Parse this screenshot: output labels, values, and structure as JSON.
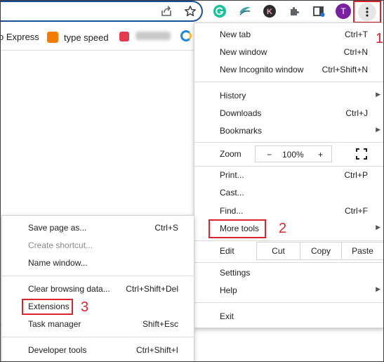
{
  "toolbar": {
    "avatar_initial": "T",
    "k_initial": "K"
  },
  "bookmarks": {
    "express": "o Express",
    "type_speed": "type speed"
  },
  "menu": {
    "new_tab": {
      "label": "New tab",
      "shortcut": "Ctrl+T"
    },
    "new_window": {
      "label": "New window",
      "shortcut": "Ctrl+N"
    },
    "new_incognito": {
      "label": "New Incognito window",
      "shortcut": "Ctrl+Shift+N"
    },
    "history": {
      "label": "History"
    },
    "downloads": {
      "label": "Downloads",
      "shortcut": "Ctrl+J"
    },
    "bookmarks": {
      "label": "Bookmarks"
    },
    "zoom": {
      "label": "Zoom",
      "minus": "−",
      "value": "100%",
      "plus": "+"
    },
    "print": {
      "label": "Print...",
      "shortcut": "Ctrl+P"
    },
    "cast": {
      "label": "Cast..."
    },
    "find": {
      "label": "Find...",
      "shortcut": "Ctrl+F"
    },
    "more_tools": {
      "label": "More tools"
    },
    "edit": {
      "label": "Edit",
      "cut": "Cut",
      "copy": "Copy",
      "paste": "Paste"
    },
    "settings": {
      "label": "Settings"
    },
    "help": {
      "label": "Help"
    },
    "exit": {
      "label": "Exit"
    }
  },
  "submenu": {
    "save_page": {
      "label": "Save page as...",
      "shortcut": "Ctrl+S"
    },
    "create_shortcut": {
      "label": "Create shortcut..."
    },
    "name_window": {
      "label": "Name window..."
    },
    "clear_browsing": {
      "label": "Clear browsing data...",
      "shortcut": "Ctrl+Shift+Del"
    },
    "extensions": {
      "label": "Extensions"
    },
    "task_manager": {
      "label": "Task manager",
      "shortcut": "Shift+Esc"
    },
    "developer_tools": {
      "label": "Developer tools",
      "shortcut": "Ctrl+Shift+I"
    }
  },
  "annotations": {
    "step1": "1",
    "step2": "2",
    "step3": "3"
  },
  "colors": {
    "highlight_red": "#d9252b",
    "omnibox_border": "#1a4fa0",
    "avatar_bg": "#7b1fa2"
  }
}
